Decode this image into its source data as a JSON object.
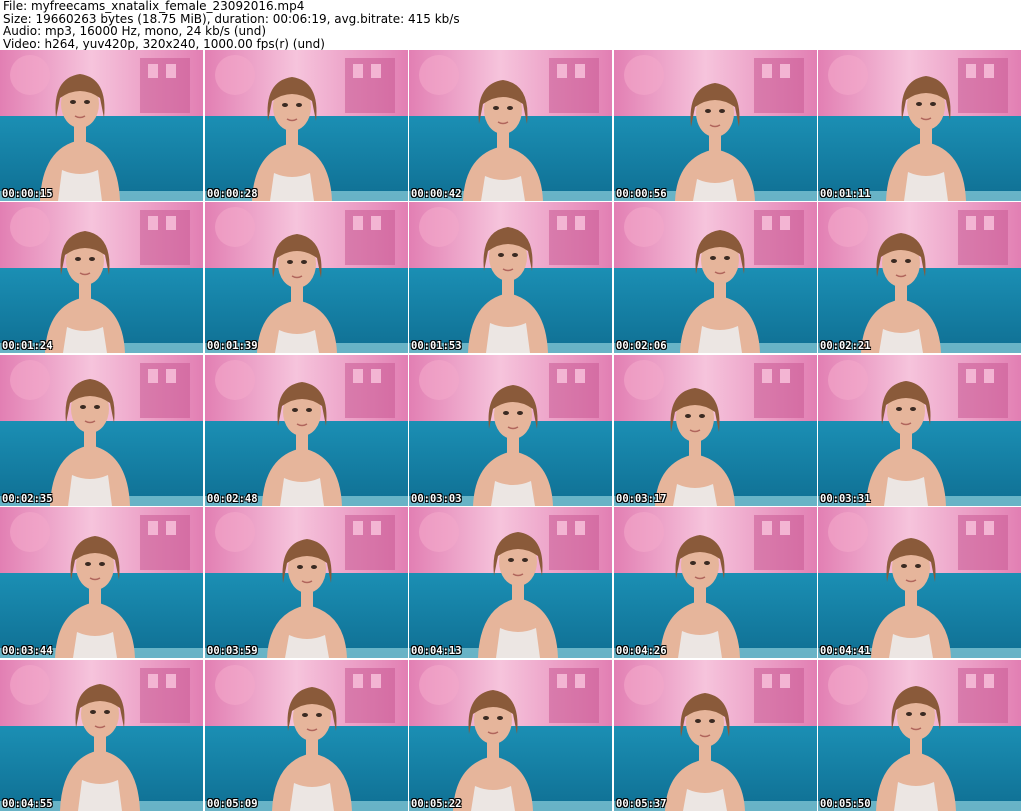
{
  "info": {
    "file_line": "File: myfreecams_xnatalix_female_23092016.mp4",
    "size_line": "Size: 19660263 bytes (18.75 MiB), duration: 00:06:19, avg.bitrate: 415 kb/s",
    "audio_line": "Audio: mp3, 16000 Hz, mono, 24 kb/s (und)",
    "video_line": "Video: h264, yuv420p, 320x240, 1000.00 fps(r) (und)"
  },
  "colors": {
    "wall": "#e27fb3",
    "wall_light": "#f6c4dc",
    "couch": "#1b8fb4",
    "couch_dark": "#0f6f93",
    "skin": "#e6b59b",
    "hair": "#8a5a3a",
    "top": "#ece6e3"
  },
  "timestamps": [
    "00:00:15",
    "00:00:28",
    "00:00:42",
    "00:00:56",
    "00:01:11",
    "00:01:24",
    "00:01:39",
    "00:01:53",
    "00:02:06",
    "00:02:21",
    "00:02:35",
    "00:02:48",
    "00:03:03",
    "00:03:17",
    "00:03:31",
    "00:03:44",
    "00:03:59",
    "00:04:13",
    "00:04:26",
    "00:04:41",
    "00:04:55",
    "00:05:09",
    "00:05:22",
    "00:05:37",
    "00:05:50"
  ]
}
